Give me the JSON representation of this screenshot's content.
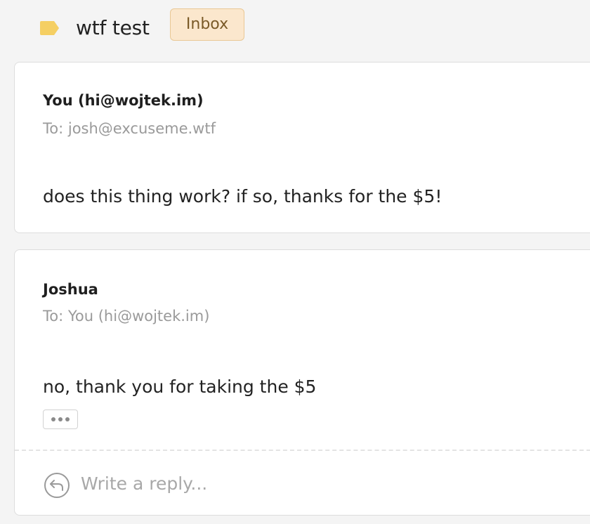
{
  "thread": {
    "label_color": "#f5cf63",
    "title": "wtf test",
    "badge": "Inbox",
    "badge_bg": "#fbe7cd"
  },
  "messages": [
    {
      "sender": "You (hi@wojtek.im)",
      "recipient": "To: josh@excuseme.wtf",
      "body": "does this thing work? if so, thanks for the $5!"
    },
    {
      "sender": "Joshua",
      "recipient": "To: You (hi@wojtek.im)",
      "body": "no, thank you for taking the $5",
      "more_icon": "ellipsis-icon"
    }
  ],
  "reply": {
    "icon": "reply-arrow-icon",
    "placeholder": "Write a reply..."
  }
}
